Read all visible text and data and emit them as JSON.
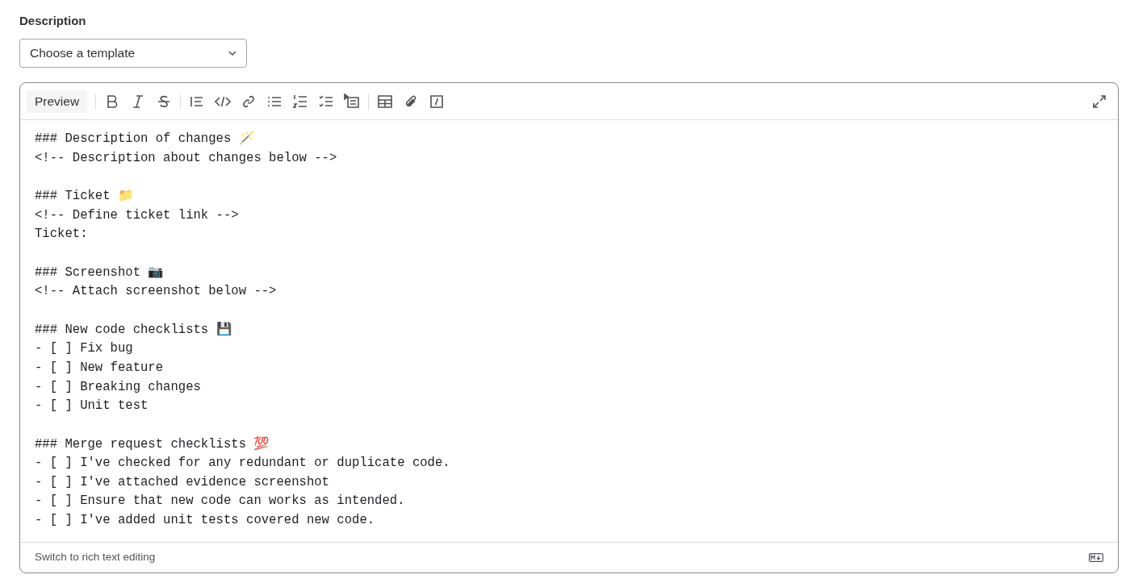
{
  "label": "Description",
  "template_select": {
    "value": "Choose a template"
  },
  "toolbar": {
    "preview_button": "Preview"
  },
  "editor": {
    "value": "### Description of changes 🪄\n<!-- Description about changes below -->\n\n### Ticket 📁\n<!-- Define ticket link -->\nTicket:\n\n### Screenshot 📷\n<!-- Attach screenshot below -->\n\n### New code checklists 💾\n- [ ] Fix bug\n- [ ] New feature\n- [ ] Breaking changes\n- [ ] Unit test\n\n### Merge request checklists 💯\n- [ ] I've checked for any redundant or duplicate code.\n- [ ] I've attached evidence screenshot\n- [ ] Ensure that new code can works as intended.\n- [ ] I've added unit tests covered new code."
  },
  "footer": {
    "switch_link": "Switch to rich text editing"
  }
}
